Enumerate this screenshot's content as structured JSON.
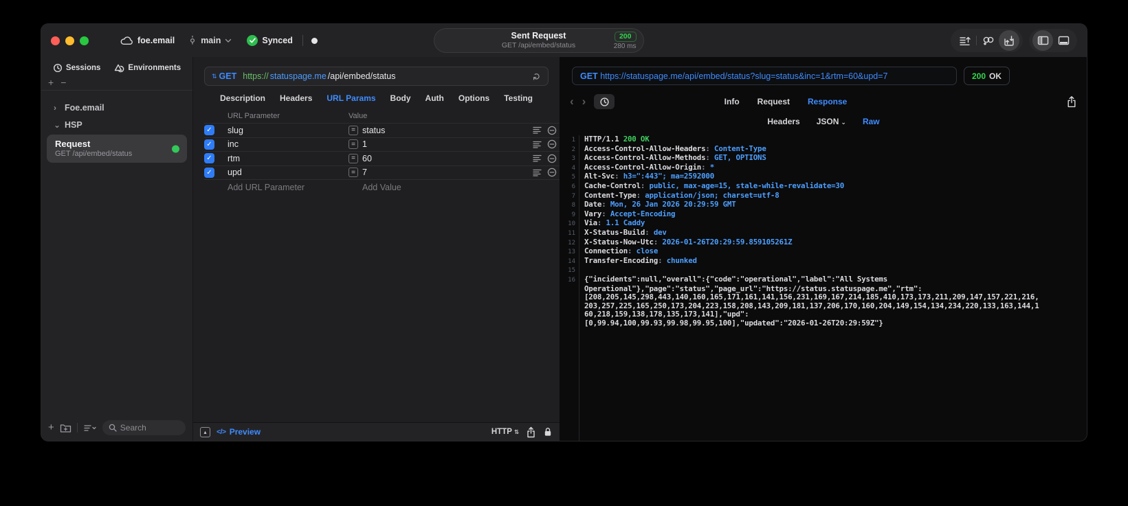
{
  "titlebar": {
    "project": "foe.email",
    "branch": "main",
    "sync_status": "Synced",
    "request_summary": {
      "title": "Sent Request",
      "subtitle": "GET /api/embed/status",
      "status_code": "200",
      "duration": "280 ms"
    }
  },
  "sidebar": {
    "tabs": [
      {
        "label": "Sessions"
      },
      {
        "label": "Environments"
      }
    ],
    "tree": [
      {
        "label": "Foe.email",
        "expanded": false
      },
      {
        "label": "HSP",
        "expanded": true
      }
    ],
    "request_item": {
      "title": "Request",
      "subtitle": "GET /api/embed/status"
    },
    "search_placeholder": "Search"
  },
  "request_panel": {
    "method": "GET",
    "url": {
      "scheme": "https://",
      "host": "statuspage.me",
      "path": "/api/embed/status"
    },
    "tabs": [
      "Description",
      "Headers",
      "URL Params",
      "Body",
      "Auth",
      "Options",
      "Testing"
    ],
    "active_tab": "URL Params",
    "params_table": {
      "columns": [
        "URL Parameter",
        "Value"
      ],
      "rows": [
        {
          "name": "slug",
          "value": "status",
          "enabled": true
        },
        {
          "name": "inc",
          "value": "1",
          "enabled": true
        },
        {
          "name": "rtm",
          "value": "60",
          "enabled": true
        },
        {
          "name": "upd",
          "value": "7",
          "enabled": true
        }
      ],
      "add_row": {
        "name_placeholder": "Add URL Parameter",
        "value_placeholder": "Add Value"
      }
    },
    "footer": {
      "preview_glyph": "</>",
      "preview_label": "Preview",
      "protocol": "HTTP"
    }
  },
  "response_panel": {
    "method": "GET",
    "url": "https://statuspage.me/api/embed/status?slug=status&inc=1&rtm=60&upd=7",
    "status_code": "200",
    "status_text": "OK",
    "tabs": [
      "Info",
      "Request",
      "Response"
    ],
    "active_tab": "Response",
    "subtabs": [
      "Headers",
      "JSON",
      "Raw"
    ],
    "active_subtab": "Raw",
    "code": {
      "status_line": {
        "protocol": "HTTP/1.1",
        "status": "200 OK"
      },
      "headers": [
        {
          "name": "Access-Control-Allow-Headers",
          "value": "Content-Type"
        },
        {
          "name": "Access-Control-Allow-Methods",
          "value": "GET, OPTIONS"
        },
        {
          "name": "Access-Control-Allow-Origin",
          "value": "*"
        },
        {
          "name": "Alt-Svc",
          "value": "h3=\":443\"; ma=2592000"
        },
        {
          "name": "Cache-Control",
          "value": "public, max-age=15, stale-while-revalidate=30"
        },
        {
          "name": "Content-Type",
          "value": "application/json; charset=utf-8"
        },
        {
          "name": "Date",
          "value": "Mon, 26 Jan 2026 20:29:59 GMT"
        },
        {
          "name": "Vary",
          "value": "Accept-Encoding"
        },
        {
          "name": "Via",
          "value": "1.1 Caddy"
        },
        {
          "name": "X-Status-Build",
          "value": "dev"
        },
        {
          "name": "X-Status-Now-Utc",
          "value": "2026-01-26T20:29:59.859105261Z"
        },
        {
          "name": "Connection",
          "value": "close"
        },
        {
          "name": "Transfer-Encoding",
          "value": "chunked"
        }
      ],
      "body_lines": [
        "{\"incidents\":null,\"overall\":{\"code\":\"operational\",\"label\":\"All Systems",
        "Operational\"},\"page\":\"status\",\"page_url\":\"https://status.statuspage.me\",\"rtm\":",
        "[208,205,145,298,443,140,160,165,171,161,141,156,231,169,167,214,185,410,173,173,211,209,147,157,221,216,",
        "203,257,225,165,250,173,204,223,158,208,143,209,181,137,206,170,160,204,149,154,134,234,220,133,163,144,1",
        "60,218,159,138,178,135,173,141],\"upd\":",
        "[0,99.94,100,99.93,99.98,99.95,100],\"updated\":\"2026-01-26T20:29:59Z\"}"
      ]
    }
  },
  "glyphs": {
    "method_sort": "⇅",
    "reload": "↻",
    "back": "‹",
    "forward": "›",
    "tree_collapsed": "›",
    "tree_expanded": "⌄",
    "plus": "+",
    "minus": "−",
    "collapse_triangle": "▴",
    "protocol_stepper": "⇅",
    "checkmark": "✓"
  },
  "colors": {
    "accent_blue": "#3f8cff",
    "value_blue": "#4d9fff",
    "status_green": "#32d74b",
    "scheme_green": "#6abf69",
    "checkbox_blue": "#2f7cf6",
    "traffic_red": "#ff5f57",
    "traffic_yellow": "#febc2e",
    "traffic_green": "#28c840"
  }
}
